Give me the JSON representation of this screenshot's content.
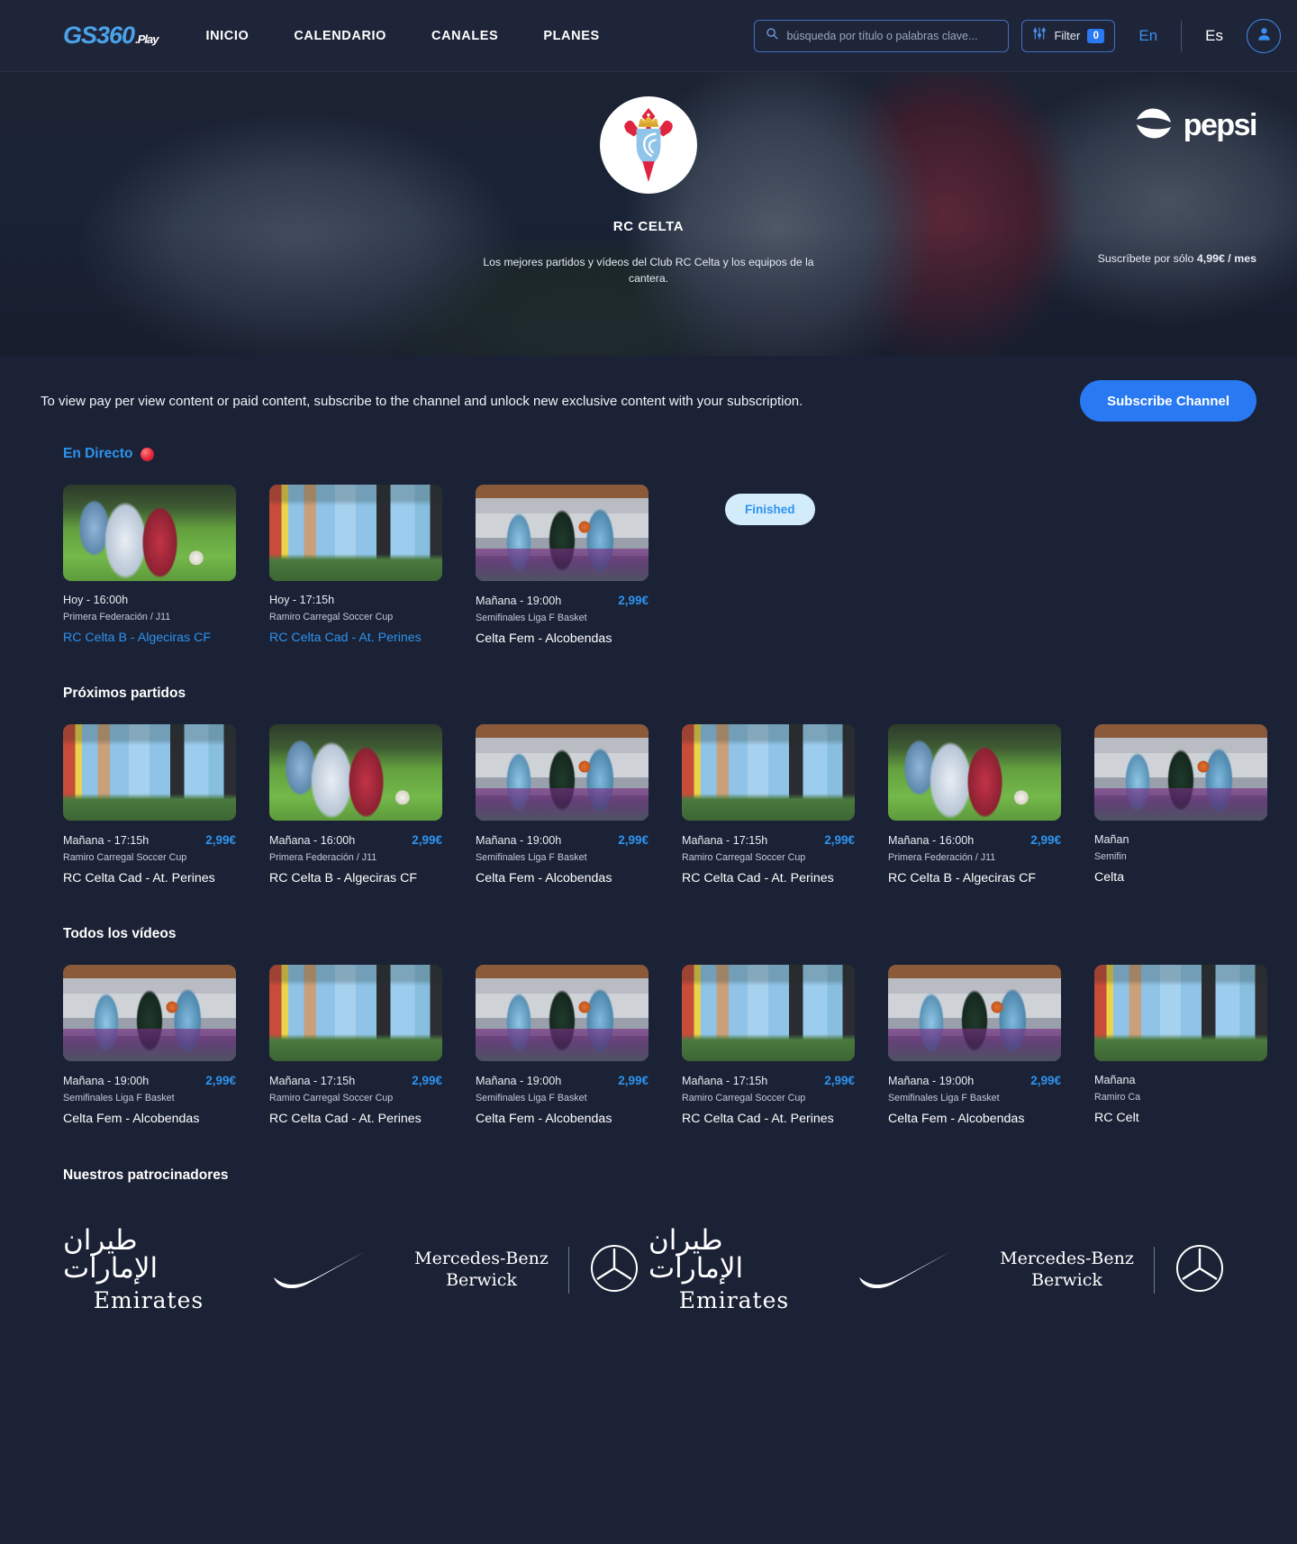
{
  "header": {
    "logo": {
      "gs": "GS",
      "num": "360",
      "play": ".Play"
    },
    "nav": [
      {
        "label": "INICIO"
      },
      {
        "label": "CALENDARIO"
      },
      {
        "label": "CANALES"
      },
      {
        "label": "PLANES"
      }
    ],
    "search": {
      "placeholder": "búsqueda por título o palabras clave...",
      "value": "",
      "icon": "search-icon"
    },
    "filter": {
      "label": "Filter",
      "count": "0",
      "icon": "sliders-icon"
    },
    "lang_en": "En",
    "lang_es": "Es",
    "avatar_icon": "user-icon"
  },
  "hero": {
    "club_name": "RC CELTA",
    "description": "Los mejores partidos y vídeos del Club RC Celta y los equipos de la cantera.",
    "sponsor": "pepsi",
    "subscribe_price_prefix": "Suscríbete por sólo ",
    "subscribe_price": "4,99€ / mes"
  },
  "banner": {
    "text": "To view pay per view content or paid content, subscribe to the channel and unlock new exclusive content with your subscription.",
    "button": "Subscribe Channel"
  },
  "sections": {
    "live": {
      "title": "En Directo",
      "badge_icon": "live-red-dot",
      "finished_label": "Finished",
      "cards": [
        {
          "time": "Hoy - 16:00h",
          "price": "",
          "competition": "Primera Federación / J11",
          "title": "RC Celta B - Algeciras CF",
          "is_link": true,
          "thumb": "soccer"
        },
        {
          "time": "Hoy - 17:15h",
          "price": "",
          "competition": "Ramiro Carregal Soccer Cup",
          "title": "RC Celta Cad - At. Perines",
          "is_link": true,
          "thumb": "team"
        },
        {
          "time": "Mañana - 19:00h",
          "price": "2,99€",
          "competition": "Semifinales Liga F Basket",
          "title": "Celta Fem - Alcobendas",
          "is_link": false,
          "thumb": "basket"
        }
      ]
    },
    "upcoming": {
      "title": "Próximos partidos",
      "cards": [
        {
          "time": "Mañana - 17:15h",
          "price": "2,99€",
          "competition": "Ramiro Carregal Soccer Cup",
          "title": "RC Celta Cad - At. Perines",
          "thumb": "team"
        },
        {
          "time": "Mañana - 16:00h",
          "price": "2,99€",
          "competition": "Primera Federación / J11",
          "title": "RC Celta B - Algeciras CF",
          "thumb": "soccer"
        },
        {
          "time": "Mañana - 19:00h",
          "price": "2,99€",
          "competition": "Semifinales Liga F Basket",
          "title": "Celta Fem - Alcobendas",
          "thumb": "basket"
        },
        {
          "time": "Mañana - 17:15h",
          "price": "2,99€",
          "competition": "Ramiro Carregal Soccer Cup",
          "title": "RC Celta Cad - At. Perines",
          "thumb": "team"
        },
        {
          "time": "Mañana - 16:00h",
          "price": "2,99€",
          "competition": "Primera Federación / J11",
          "title": "RC Celta B - Algeciras CF",
          "thumb": "soccer"
        },
        {
          "time": "Mañan",
          "price": "",
          "competition": "Semifin",
          "title": "Celta",
          "thumb": "basket"
        }
      ]
    },
    "videos": {
      "title": "Todos los vídeos",
      "cards": [
        {
          "time": "Mañana - 19:00h",
          "price": "2,99€",
          "competition": "Semifinales Liga F Basket",
          "title": "Celta Fem - Alcobendas",
          "thumb": "basket"
        },
        {
          "time": "Mañana - 17:15h",
          "price": "2,99€",
          "competition": "Ramiro Carregal Soccer Cup",
          "title": "RC Celta Cad - At. Perines",
          "thumb": "team"
        },
        {
          "time": "Mañana - 19:00h",
          "price": "2,99€",
          "competition": "Semifinales Liga F Basket",
          "title": "Celta Fem - Alcobendas",
          "thumb": "basket"
        },
        {
          "time": "Mañana - 17:15h",
          "price": "2,99€",
          "competition": "Ramiro Carregal Soccer Cup",
          "title": "RC Celta Cad - At. Perines",
          "thumb": "team"
        },
        {
          "time": "Mañana - 19:00h",
          "price": "2,99€",
          "competition": "Semifinales Liga F Basket",
          "title": "Celta Fem - Alcobendas",
          "thumb": "basket"
        },
        {
          "time": "Mañana",
          "price": "",
          "competition": "Ramiro Ca",
          "title": "RC Celt",
          "thumb": "team"
        }
      ]
    },
    "sponsors": {
      "title": "Nuestros patrocinadores",
      "items": [
        {
          "name": "Emirates",
          "arabic": "طيران الإمارات",
          "type": "emirates"
        },
        {
          "name": "Nike",
          "type": "nike"
        },
        {
          "name": "Mercedes-Benz Berwick",
          "line1": "Mercedes-Benz",
          "line2": "Berwick",
          "type": "mercedes"
        },
        {
          "name": "Emirates",
          "arabic": "طيران الإمارات",
          "type": "emirates"
        },
        {
          "name": "Nike",
          "type": "nike"
        },
        {
          "name": "Mercedes-Benz Berwick",
          "line1": "Mercedes-Benz",
          "line2": "Berwick",
          "type": "mercedes"
        }
      ]
    }
  },
  "colors": {
    "accent": "#2979f2",
    "link": "#2e93ef",
    "bg": "#1b2235",
    "header_bg": "#1f2539"
  }
}
